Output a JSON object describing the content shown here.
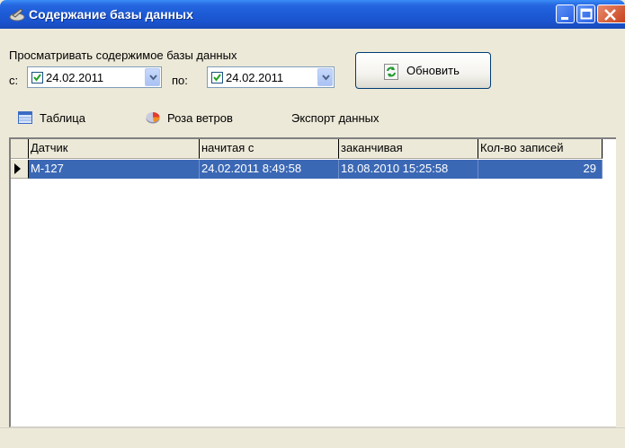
{
  "window": {
    "title": "Содержание базы данных"
  },
  "filter": {
    "caption": "Просматривать содержимое базы данных",
    "from_label": "с:",
    "from_value": "24.02.2011",
    "from_checked": true,
    "to_label": "по:",
    "to_value": "24.02.2011",
    "to_checked": true
  },
  "refresh_button": {
    "label": "Обновить",
    "icon": "refresh-icon"
  },
  "toolbar": {
    "items": [
      {
        "label": "Таблица",
        "icon": "table-icon"
      },
      {
        "label": "Роза ветров",
        "icon": "pie-chart-icon"
      },
      {
        "label": "Экспорт данных",
        "icon": ""
      }
    ]
  },
  "table": {
    "columns": [
      "Датчик",
      "начитая с",
      "заканчивая",
      "Кол-во записей"
    ],
    "rows": [
      {
        "sensor": "M-127",
        "start": "24.02.2011 8:49:58",
        "end": "18.08.2010 15:25:58",
        "count": "29",
        "selected": true
      }
    ]
  },
  "colors": {
    "title_bar": "#2566e0",
    "selection": "#3b68b5",
    "window_bg": "#ece9d8"
  }
}
